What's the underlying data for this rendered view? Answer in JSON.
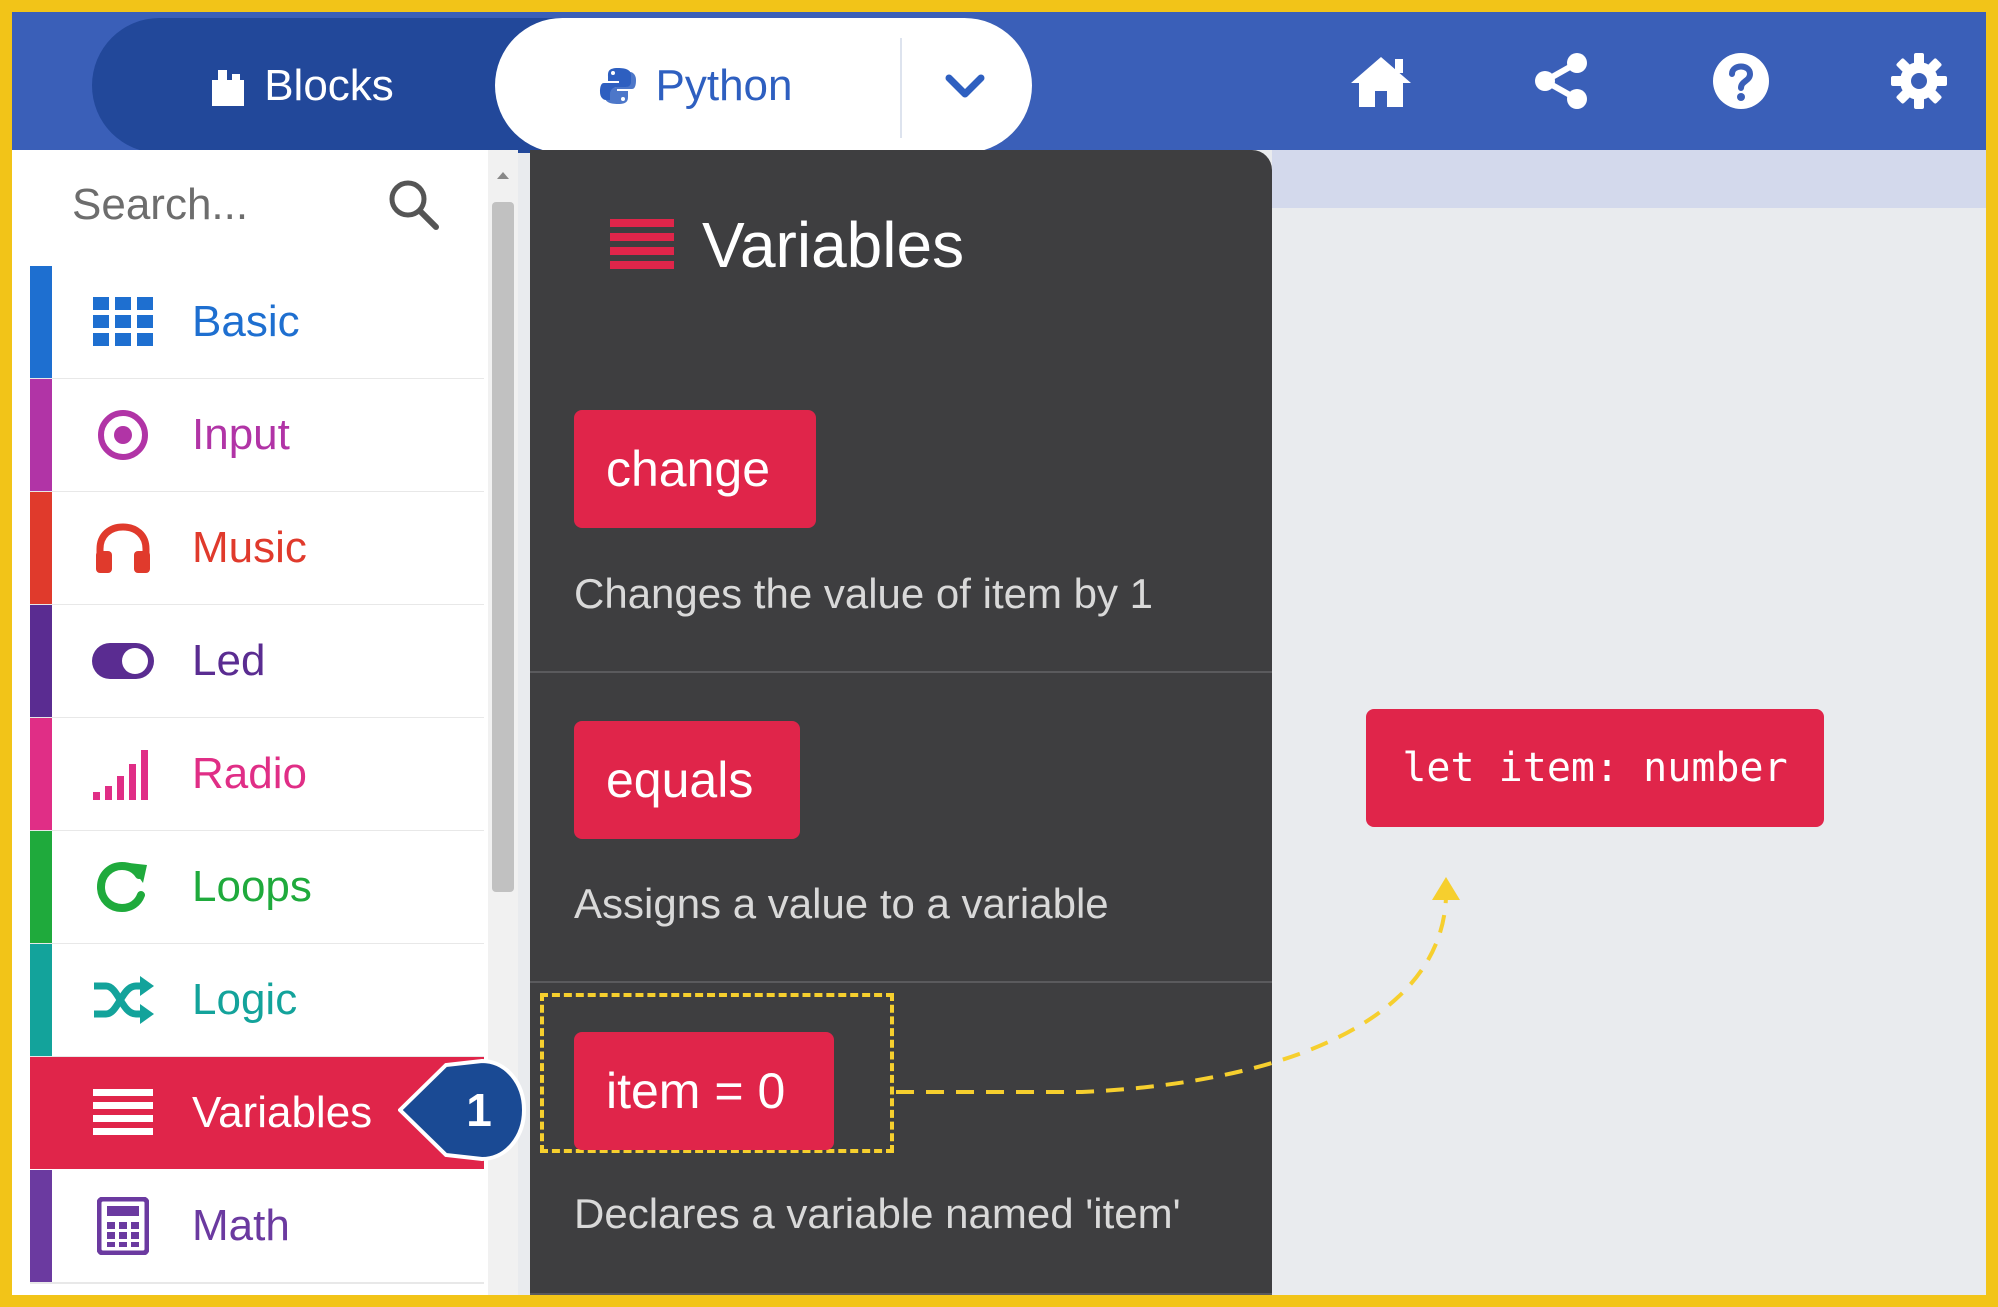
{
  "header": {
    "tabs": [
      {
        "label": "Blocks",
        "icon": "puzzle-icon"
      },
      {
        "label": "Python",
        "icon": "python-icon"
      }
    ],
    "dropdown_icon": "chevron-down-icon",
    "actions": [
      "home-icon",
      "share-icon",
      "help-icon",
      "gear-icon"
    ]
  },
  "sidebar": {
    "search_placeholder": "Search...",
    "categories": [
      {
        "label": "Basic",
        "color": "#1e6fd0",
        "icon": "grid-icon"
      },
      {
        "label": "Input",
        "color": "#b134a6",
        "icon": "target-icon"
      },
      {
        "label": "Music",
        "color": "#e03a2c",
        "icon": "headphones-icon"
      },
      {
        "label": "Led",
        "color": "#5a2c91",
        "icon": "toggle-icon"
      },
      {
        "label": "Radio",
        "color": "#e02e86",
        "icon": "signal-bars-icon"
      },
      {
        "label": "Loops",
        "color": "#1faa3c",
        "icon": "refresh-icon"
      },
      {
        "label": "Logic",
        "color": "#13a39b",
        "icon": "shuffle-icon"
      },
      {
        "label": "Variables",
        "color": "#e0254a",
        "icon": "list-icon",
        "selected": true
      },
      {
        "label": "Math",
        "color": "#6b3aa0",
        "icon": "calculator-icon"
      }
    ]
  },
  "flyout": {
    "title": "Variables",
    "items": [
      {
        "block": "change",
        "description": "Changes the value of item by 1"
      },
      {
        "block": "equals",
        "description": "Assigns a value to a variable"
      },
      {
        "block": "item = 0",
        "description": "Declares a variable named 'item'"
      }
    ]
  },
  "workspace": {
    "code_block": "let item: number"
  },
  "annotation": {
    "step_number": "1",
    "accent_color": "#f6cf2e"
  },
  "colors": {
    "header": "#3a5fb8",
    "block": "#e0254a",
    "flyout": "#3e3e40",
    "frame": "#f2c418"
  }
}
